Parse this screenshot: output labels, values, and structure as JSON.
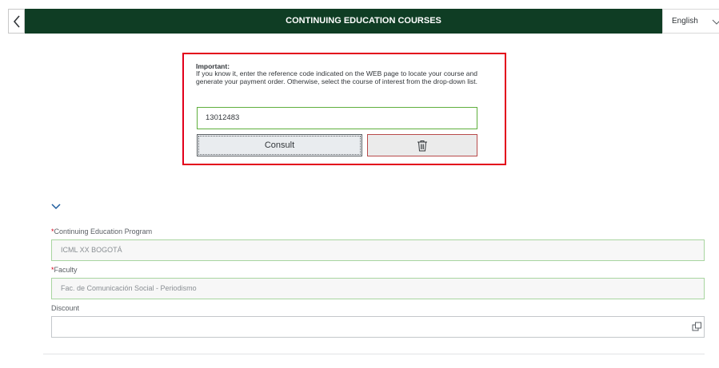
{
  "header": {
    "title": "CONTINUING EDUCATION COURSES",
    "language": "English",
    "background_color": "#0f3d24"
  },
  "notice": {
    "title": "Important:",
    "text": "If you know it, enter the reference code indicated on the WEB page to locate your course and generate your payment order. Otherwise, select the course of interest from the drop-down list.",
    "reference_value": "13012483",
    "consult_label": "Consult",
    "clear_icon": "trash-icon",
    "border_color": "#e3001b"
  },
  "form": {
    "program": {
      "label": "Continuing Education Program",
      "required": "*",
      "value": "ICML XX BOGOTÁ"
    },
    "faculty": {
      "label": "Faculty",
      "required": "*",
      "value": "Fac. de Comunicación Social - Periodismo"
    },
    "discount": {
      "label": "Discount",
      "value": "",
      "help_icon": "value-help-icon"
    }
  }
}
